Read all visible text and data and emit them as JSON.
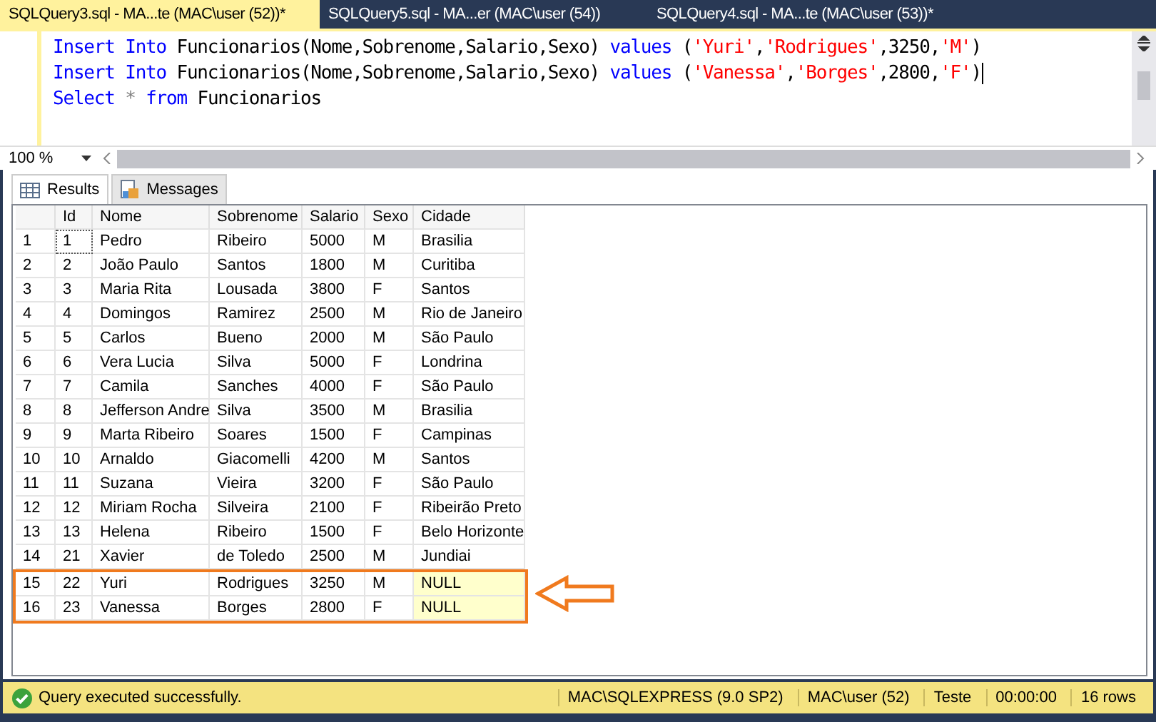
{
  "tabs": [
    {
      "label": "SQLQuery3.sql - MA...te (MAC\\user (52))*",
      "selected": true
    },
    {
      "label": "SQLQuery5.sql - MA...er (MAC\\user (54))",
      "selected": false
    },
    {
      "label": "SQLQuery4.sql - MA...te (MAC\\user (53))*",
      "selected": false
    }
  ],
  "editor": {
    "lines": [
      [
        {
          "kind": "keyword",
          "text": "Insert Into"
        },
        {
          "kind": "plain",
          "text": " Funcionarios(Nome,Sobrenome,Salario,Sexo) "
        },
        {
          "kind": "keyword",
          "text": "values"
        },
        {
          "kind": "plain",
          "text": " ("
        },
        {
          "kind": "string",
          "text": "'Yuri'"
        },
        {
          "kind": "plain",
          "text": ","
        },
        {
          "kind": "string",
          "text": "'Rodrigues'"
        },
        {
          "kind": "plain",
          "text": ",3250,"
        },
        {
          "kind": "string",
          "text": "'M'"
        },
        {
          "kind": "plain",
          "text": ")"
        }
      ],
      [
        {
          "kind": "keyword",
          "text": "Insert Into"
        },
        {
          "kind": "plain",
          "text": " Funcionarios(Nome,Sobrenome,Salario,Sexo) "
        },
        {
          "kind": "keyword",
          "text": "values"
        },
        {
          "kind": "plain",
          "text": " ("
        },
        {
          "kind": "string",
          "text": "'Vanessa'"
        },
        {
          "kind": "plain",
          "text": ","
        },
        {
          "kind": "string",
          "text": "'Borges'"
        },
        {
          "kind": "plain",
          "text": ",2800,"
        },
        {
          "kind": "string",
          "text": "'F'"
        },
        {
          "kind": "plain",
          "text": ")"
        }
      ],
      [
        {
          "kind": "keyword",
          "text": "Select"
        },
        {
          "kind": "operator",
          "text": " * "
        },
        {
          "kind": "keyword",
          "text": "from"
        },
        {
          "kind": "plain",
          "text": " Funcionarios"
        }
      ]
    ],
    "zoom": "100 %"
  },
  "result_tabs": [
    {
      "label": "Results",
      "selected": true
    },
    {
      "label": "Messages",
      "selected": false
    }
  ],
  "table": {
    "columns": [
      "Id",
      "Nome",
      "Sobrenome",
      "Salario",
      "Sexo",
      "Cidade"
    ],
    "rows": [
      {
        "num": "1",
        "cells": [
          "1",
          "Pedro",
          "Ribeiro",
          "5000",
          "M",
          "Brasilia"
        ],
        "null_city": false,
        "highlighted": false
      },
      {
        "num": "2",
        "cells": [
          "2",
          "João Paulo",
          "Santos",
          "1800",
          "M",
          "Curitiba"
        ],
        "null_city": false,
        "highlighted": false
      },
      {
        "num": "3",
        "cells": [
          "3",
          "Maria Rita",
          "Lousada",
          "3800",
          "F",
          "Santos"
        ],
        "null_city": false,
        "highlighted": false
      },
      {
        "num": "4",
        "cells": [
          "4",
          "Domingos",
          "Ramirez",
          "2500",
          "M",
          "Rio de Janeiro"
        ],
        "null_city": false,
        "highlighted": false
      },
      {
        "num": "5",
        "cells": [
          "5",
          "Carlos",
          "Bueno",
          "2000",
          "M",
          "São Paulo"
        ],
        "null_city": false,
        "highlighted": false
      },
      {
        "num": "6",
        "cells": [
          "6",
          "Vera Lucia",
          "Silva",
          "5000",
          "F",
          "Londrina"
        ],
        "null_city": false,
        "highlighted": false
      },
      {
        "num": "7",
        "cells": [
          "7",
          "Camila",
          "Sanches",
          "4000",
          "F",
          "São Paulo"
        ],
        "null_city": false,
        "highlighted": false
      },
      {
        "num": "8",
        "cells": [
          "8",
          "Jefferson Andre",
          "Silva",
          "3500",
          "M",
          "Brasilia"
        ],
        "null_city": false,
        "highlighted": false
      },
      {
        "num": "9",
        "cells": [
          "9",
          "Marta Ribeiro",
          "Soares",
          "1500",
          "F",
          "Campinas"
        ],
        "null_city": false,
        "highlighted": false
      },
      {
        "num": "10",
        "cells": [
          "10",
          "Arnaldo",
          "Giacomelli",
          "4200",
          "M",
          "Santos"
        ],
        "null_city": false,
        "highlighted": false
      },
      {
        "num": "11",
        "cells": [
          "11",
          "Suzana",
          "Vieira",
          "3200",
          "F",
          "São Paulo"
        ],
        "null_city": false,
        "highlighted": false
      },
      {
        "num": "12",
        "cells": [
          "12",
          "Miriam Rocha",
          "Silveira",
          "2100",
          "F",
          "Ribeirão Preto"
        ],
        "null_city": false,
        "highlighted": false
      },
      {
        "num": "13",
        "cells": [
          "13",
          "Helena",
          "Ribeiro",
          "1500",
          "F",
          "Belo Horizonte"
        ],
        "null_city": false,
        "highlighted": false
      },
      {
        "num": "14",
        "cells": [
          "21",
          "Xavier",
          "de Toledo",
          "2500",
          "M",
          "Jundiai"
        ],
        "null_city": false,
        "highlighted": false
      },
      {
        "num": "15",
        "cells": [
          "22",
          "Yuri",
          "Rodrigues",
          "3250",
          "M",
          "NULL"
        ],
        "null_city": true,
        "highlighted": true
      },
      {
        "num": "16",
        "cells": [
          "23",
          "Vanessa",
          "Borges",
          "2800",
          "F",
          "NULL"
        ],
        "null_city": true,
        "highlighted": true
      }
    ]
  },
  "status_bar": {
    "message": "Query executed successfully.",
    "server": "MAC\\SQLEXPRESS (9.0 SP2)",
    "user": "MAC\\user (52)",
    "database": "Teste",
    "elapsed": "00:00:00",
    "rows": "16 rows"
  }
}
